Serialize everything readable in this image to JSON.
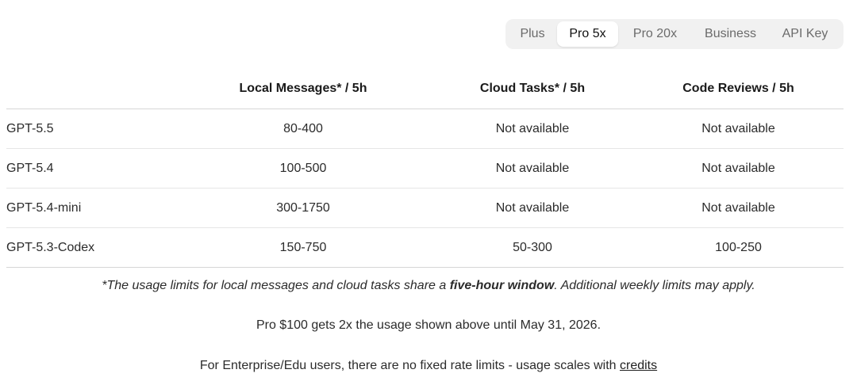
{
  "tabs": [
    {
      "label": "Plus",
      "active": false
    },
    {
      "label": "Pro 5x",
      "active": true
    },
    {
      "label": "Pro 20x",
      "active": false
    },
    {
      "label": "Business",
      "active": false
    },
    {
      "label": "API Key",
      "active": false
    }
  ],
  "table": {
    "headers": [
      "",
      "Local Messages* / 5h",
      "Cloud Tasks* / 5h",
      "Code Reviews / 5h"
    ],
    "rows": [
      {
        "model": "GPT-5.5",
        "local": "80-400",
        "cloud": "Not available",
        "reviews": "Not available"
      },
      {
        "model": "GPT-5.4",
        "local": "100-500",
        "cloud": "Not available",
        "reviews": "Not available"
      },
      {
        "model": "GPT-5.4-mini",
        "local": "300-1750",
        "cloud": "Not available",
        "reviews": "Not available"
      },
      {
        "model": "GPT-5.3-Codex",
        "local": "150-750",
        "cloud": "50-300",
        "reviews": "100-250"
      }
    ]
  },
  "notes": {
    "usage_prefix": "*The usage limits for local messages and cloud tasks share a ",
    "usage_bold": "five-hour window",
    "usage_suffix": ". Additional weekly limits may apply.",
    "pro_offer": "Pro $100 gets 2x the usage shown above until May 31, 2026.",
    "enterprise_prefix": "For Enterprise/Edu users, there are no fixed rate limits - usage scales with ",
    "credits_link": "credits"
  }
}
